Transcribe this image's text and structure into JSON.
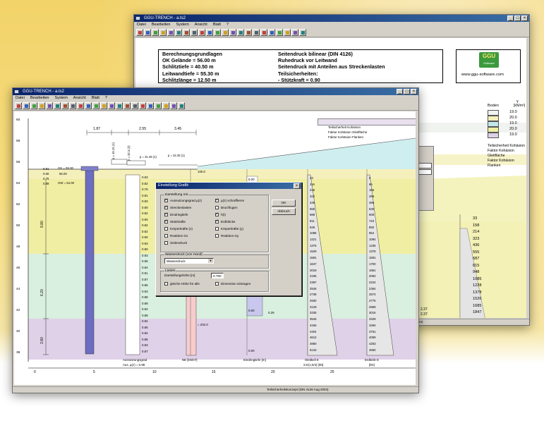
{
  "back_window": {
    "title": "GGU-TRENCH - a.ts2",
    "menu": [
      "Datei",
      "Bearbeiten",
      "System",
      "Ansicht",
      "Blatt",
      "?"
    ],
    "info_left": [
      "Berechnungsgrundlagen",
      "OK Gelände = 56.00 m",
      "Schlitztiefe = 40.50 m",
      "Leitwandtiefe = 55.30 m",
      "Schlitzlänge = 12.50 m"
    ],
    "info_right": [
      "Seitendruck bilinear (DIN 4126)",
      "Ruhedruck vor Leitwand",
      "Seitendruck mit Anteilen aus Streckenlasten",
      "Teilsicherheiten:",
      " - Stützkraft = 0.90"
    ],
    "logo_text": "GGU",
    "logo_subtext": "Software",
    "website": "www.ggu-software.com",
    "soil_legend": {
      "header_soil": "Boden",
      "header_gamma": "γ",
      "header_unit": "[kN/m³]",
      "values": [
        "19.0",
        "20.0",
        "19.0",
        "20.0",
        "19.0"
      ],
      "colors": [
        "#f1f3f0",
        "#f5f0bb",
        "#c4e7e9",
        "#f0eea2",
        "#dcd0e6"
      ],
      "footer": [
        "Teilsicherheit Kohäsion",
        "Faktor Kohäsion Gleitfläche",
        "Faktor Kohäsion Flanken"
      ]
    },
    "side_values": [
      "33",
      "158",
      "214",
      "323",
      "436",
      "555",
      "687",
      "815",
      "948",
      "1085",
      "1228",
      "1378",
      "1526",
      "1685",
      "1847"
    ],
    "small_values": [
      "2.37",
      "2.37"
    ],
    "status": "Teilsicherheitskonzept (DIN 4126 Aug 2004)"
  },
  "front_window": {
    "title": "GGU-TRENCH - a.ts2",
    "menu": [
      "Datei",
      "Bearbeiten",
      "System",
      "Ansicht",
      "Blatt",
      "?"
    ],
    "status": "Teilsicherheitskonzept (DIN 4126 Aug 2004)",
    "y_axis": [
      "60",
      "58",
      "56",
      "54",
      "52",
      "50",
      "48",
      "46",
      "44",
      "42",
      "40",
      "38"
    ],
    "x_axis": [
      "0",
      "5",
      "10",
      "15",
      "20",
      "25"
    ],
    "dims": [
      "1.87",
      "2.55",
      "3.45"
    ],
    "loads": [
      "p = 16.15 (1)",
      "p = 32.3 (2)",
      "p = 31.48 (1)",
      "p = 22.35 (1)"
    ],
    "level_labels": [
      "56.00",
      "55.30",
      "54.30",
      "54.00",
      "55.50"
    ],
    "left_depths": [
      "0.81",
      "0.60",
      "0.76",
      "0.89"
    ],
    "gk_label": "GK = 55.00",
    "gw_label": "GW = 54.00",
    "vertical_dims": [
      "9.80",
      "6.20",
      "3.80"
    ],
    "col1_values": [
      "0.83",
      "0.82",
      "0.76",
      "0.81",
      "0.83",
      "0.80",
      "0.82",
      "0.90",
      "0.84",
      "0.82",
      "0.90",
      "0.93",
      "0.90",
      "0.93",
      "0.95",
      "0.84",
      "0.91",
      "0.87",
      "0.86",
      "0.93",
      "0.88",
      "0.89",
      "0.92",
      "0.88",
      "0.84",
      "0.86",
      "0.84",
      "0.85",
      "0.83",
      "0.87"
    ],
    "col1_label_1": "Ausnutzungsgrad",
    "col1_label_2": "Aus. µ(z) = 0.88",
    "col2_label": "NE [kN/m²]",
    "col2_top": "100.0",
    "col2_bottom": "= 202.0",
    "col3_label": "Eindringtiefe [m]",
    "col3_values": [
      "0.00",
      "0.00",
      "0.29",
      "0.00"
    ],
    "col3_top": "5.00",
    "col4_label": "Gleitkeil E",
    "col4_sub": "S.E(ν,krit) [kN]",
    "col4_values": [
      "33",
      "116",
      "216",
      "322",
      "435",
      "555",
      "688",
      "811",
      "948",
      "1085",
      "1221",
      "1376",
      "1529",
      "1681",
      "1847",
      "2018",
      "2195",
      "2387",
      "2546",
      "2738",
      "2930",
      "3129",
      "3335",
      "3546",
      "4165",
      "4404",
      "4612",
      "4860",
      "5133"
    ],
    "col5_label": "Erdkeile E",
    "col5_sub": "[kN]",
    "col5_values": [
      "5",
      "66",
      "155",
      "269",
      "396",
      "530",
      "608",
      "723",
      "850",
      "954",
      "1094",
      "1235",
      "1378",
      "1591",
      "1700",
      "1861",
      "2052",
      "2224",
      "2364",
      "2574",
      "2776",
      "2859",
      "3016",
      "3329",
      "3494",
      "3751",
      "4059",
      "4253",
      "4650"
    ]
  },
  "dialog": {
    "title": "Einstellung Grafik",
    "group1": "Darstellung mit",
    "checkboxes_left": [
      {
        "label": "Ausnutzungsgrad µ(z)",
        "on": true
      },
      {
        "label": "Streckenlasten",
        "on": true
      },
      {
        "label": "Eindringtiefe",
        "on": true
      },
      {
        "label": "Stützkräfte",
        "on": true
      },
      {
        "label": "Körperkräfte (x)",
        "on": false
      },
      {
        "label": "Reaktion Gx",
        "on": false
      },
      {
        "label": "Seitendruck",
        "on": false
      }
    ],
    "checkboxes_right": [
      {
        "label": "µ(z) schraffieren",
        "on": true
      },
      {
        "label": "Bruchfugen",
        "on": false
      },
      {
        "label": "h(t)",
        "on": true
      },
      {
        "label": "Erdblöcke",
        "on": true
      },
      {
        "label": "Körperkräfte (y)",
        "on": false
      },
      {
        "label": "Reaktion Gy",
        "on": false
      }
    ],
    "ok": "OK",
    "cancel": "Abbruch",
    "group2": "Wasserdruck (von Hand)",
    "dropdown": "Wasserdruck",
    "group3": "Lasten",
    "height_label": "Darstellungshöhe [m]",
    "height_value": "0.750",
    "cb_same_height": "gleiche Höhe für alle",
    "cb_dimension": "Dimension eintragen"
  }
}
